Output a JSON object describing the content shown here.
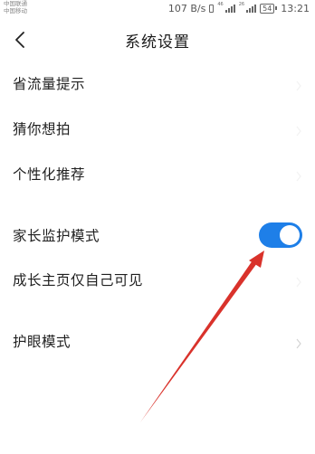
{
  "status_bar": {
    "carrier_1": "中国联通",
    "carrier_2": "中国移动",
    "speed": "107 B/s",
    "network_1": "46",
    "network_2": "26",
    "battery": "54",
    "time": "13:21"
  },
  "header": {
    "back_icon": "chevron-left-icon",
    "title": "系统设置"
  },
  "settings": {
    "items": [
      {
        "label": "省流量提示",
        "control": "chevron"
      },
      {
        "label": "猜你想拍",
        "control": "chevron"
      },
      {
        "label": "个性化推荐",
        "control": "chevron"
      },
      {
        "label": "家长监护模式",
        "control": "toggle",
        "toggle_on": true
      },
      {
        "label": "成长主页仅自己可见",
        "control": "chevron"
      },
      {
        "label": "护眼模式",
        "control": "chevron"
      }
    ]
  },
  "colors": {
    "toggle_on": "#1e7fe8",
    "annotation_arrow": "#d9322b"
  }
}
